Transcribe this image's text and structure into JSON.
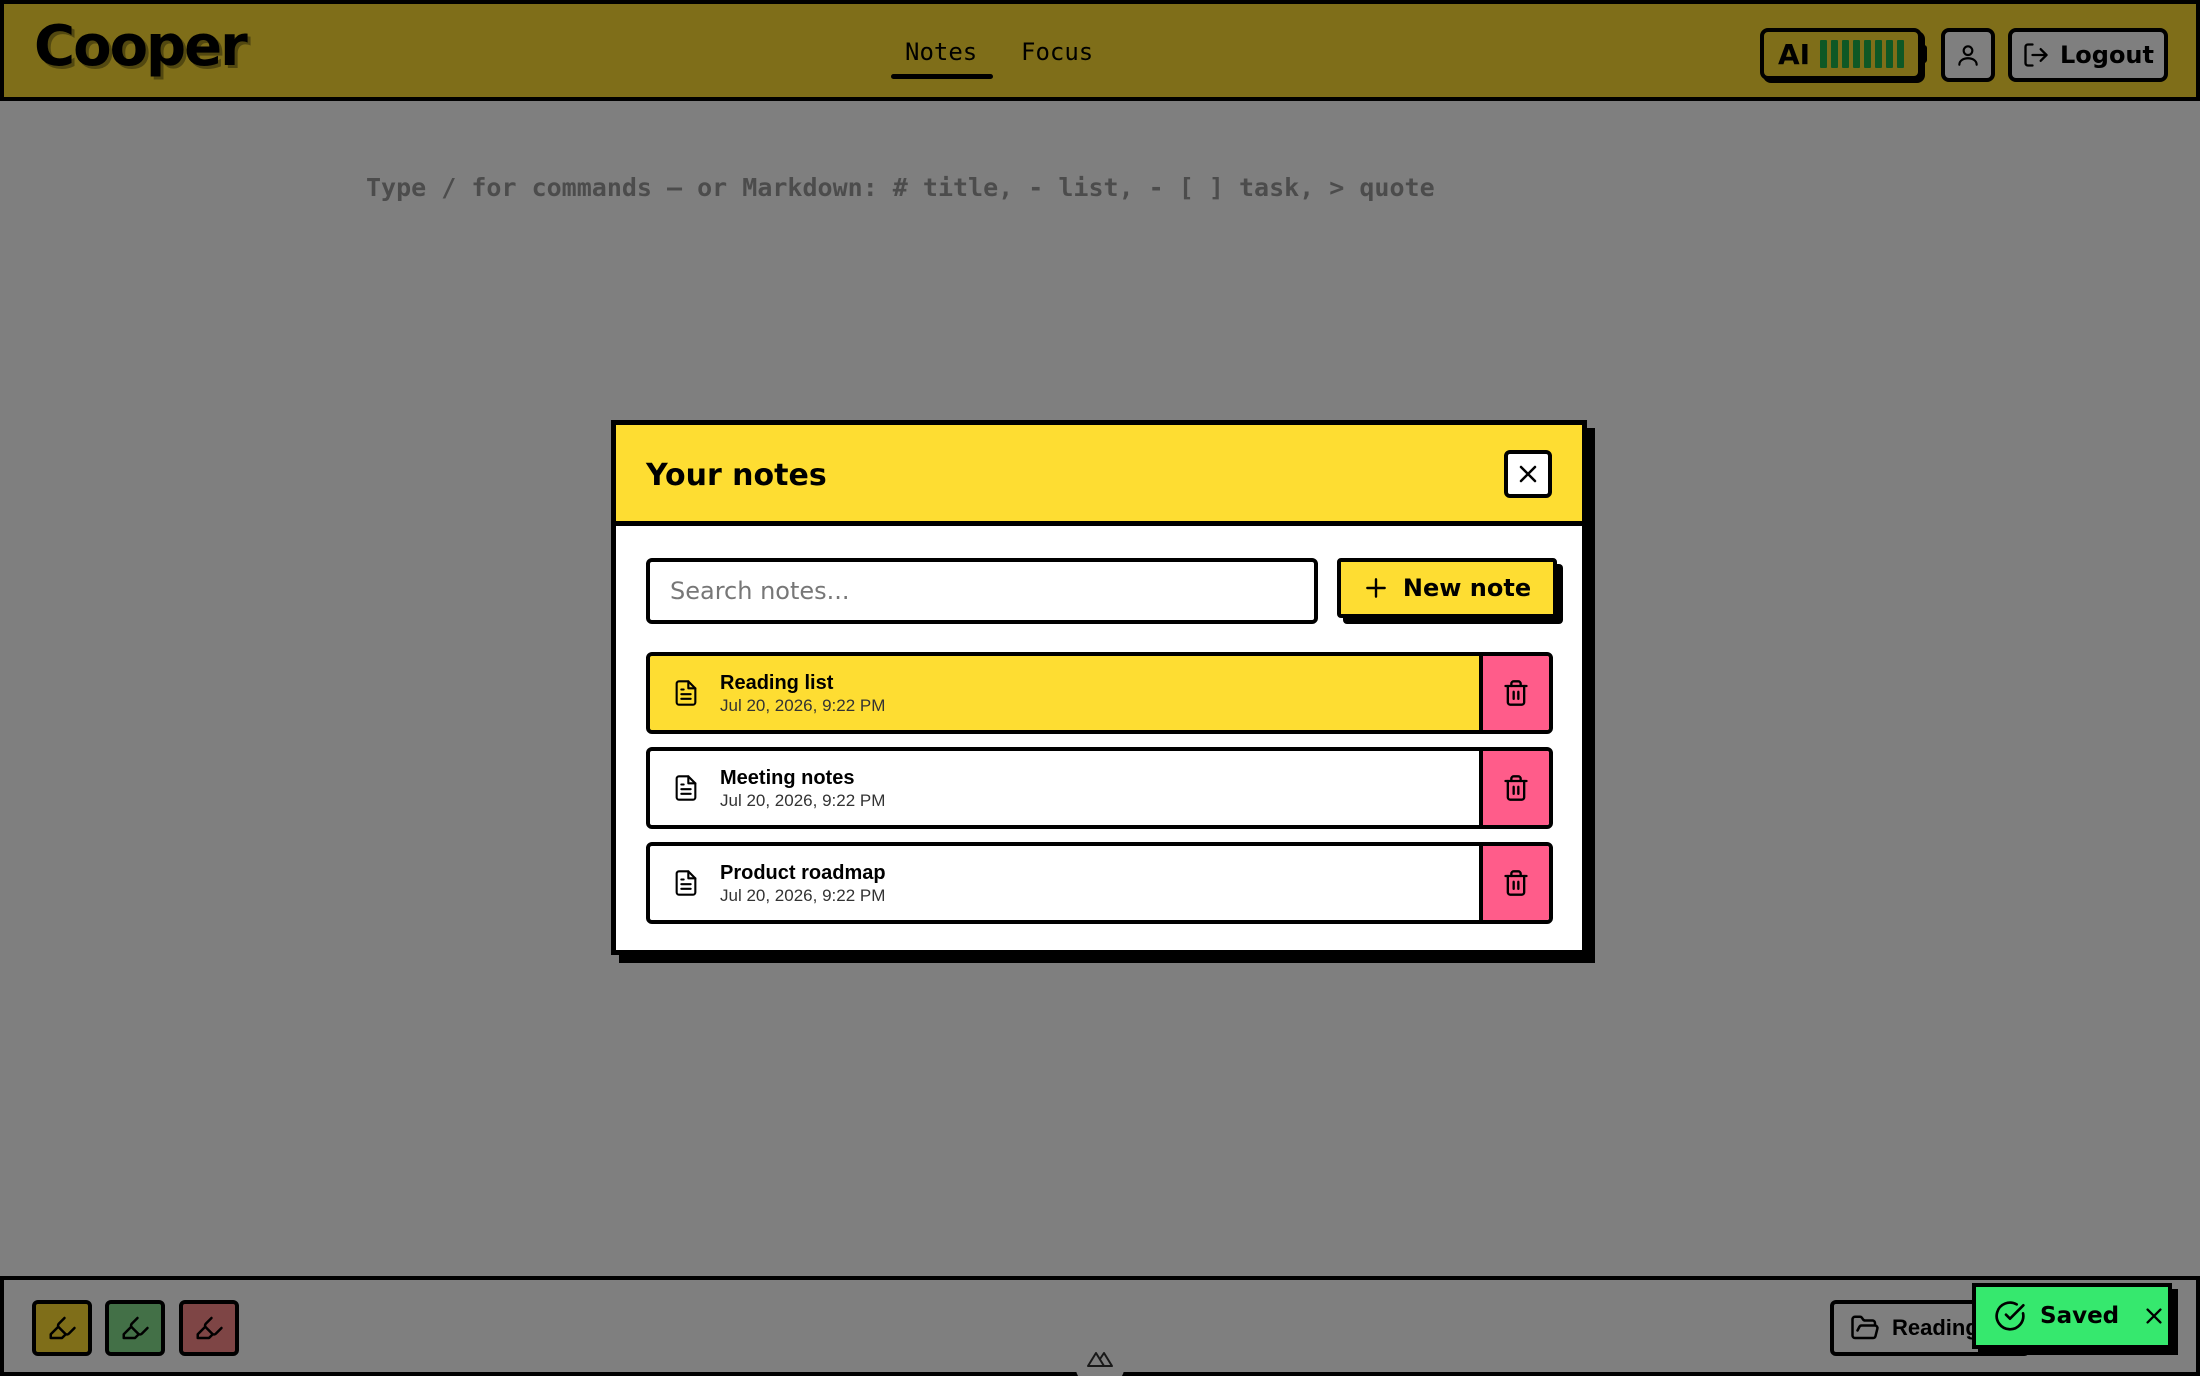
{
  "header": {
    "logo": "Cooper",
    "tabs": [
      {
        "label": "Notes",
        "active": true
      },
      {
        "label": "Focus",
        "active": false
      }
    ],
    "ai_label": "AI",
    "ai_battery_level": 1.0,
    "logout_label": "Logout"
  },
  "editor": {
    "placeholder": "Type / for commands — or Markdown: # title, - list, - [ ] task, > quote"
  },
  "modal": {
    "title": "Your notes",
    "search_placeholder": "Search notes...",
    "new_note_label": "New note",
    "notes": [
      {
        "title": "Reading list",
        "date": "Jul 20, 2026, 9:22 PM",
        "active": true
      },
      {
        "title": "Meeting notes",
        "date": "Jul 20, 2026, 9:22 PM",
        "active": false
      },
      {
        "title": "Product roadmap",
        "date": "Jul 20, 2026, 9:22 PM",
        "active": false
      }
    ]
  },
  "footer": {
    "highlighters": [
      {
        "name": "yellow",
        "color": "#fedd32"
      },
      {
        "name": "green",
        "color": "#86e08f"
      },
      {
        "name": "red",
        "color": "#fd8a8a"
      }
    ],
    "current_folder": "Reading"
  },
  "toast": {
    "label": "Saved"
  },
  "colors": {
    "accent_yellow": "#fedd32",
    "danger_pink": "#ff5c8a",
    "success_green": "#36e86e",
    "battery_green": "#1fb14a"
  }
}
